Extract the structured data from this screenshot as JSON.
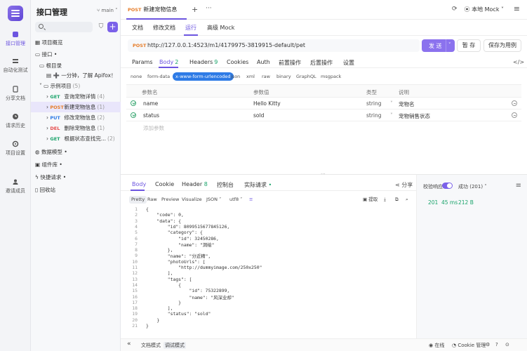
{
  "rail": {
    "items": [
      {
        "label": "接口管理",
        "icon": "api-icon"
      },
      {
        "label": "自动化测试",
        "icon": "automation-icon"
      },
      {
        "label": "分享文档",
        "icon": "share-doc-icon"
      },
      {
        "label": "请求历史",
        "icon": "history-icon"
      },
      {
        "label": "项目设置",
        "icon": "settings-icon"
      },
      {
        "label": "邀请成员",
        "icon": "invite-icon"
      }
    ]
  },
  "tree": {
    "project_title": "接口管理",
    "branch": "main",
    "nodes": {
      "overview": "项目概览",
      "api": "接口",
      "root": "根目录",
      "welcome": "➕ 一分钟，了解 Apifox！",
      "example": "示例项目",
      "example_count": "(5)",
      "data_model": "数据模型",
      "component": "组件库",
      "quick_request": "快捷请求",
      "trash": "回收站"
    },
    "endpoints": [
      {
        "method": "GET",
        "name": "查询宠物详情",
        "count": "(4)"
      },
      {
        "method": "POST",
        "name": "新建宠物信息",
        "count": "(1)"
      },
      {
        "method": "PUT",
        "name": "修改宠物信息",
        "count": "(2)"
      },
      {
        "method": "DEL",
        "name": "删除宠物信息",
        "count": "(1)"
      },
      {
        "method": "GET",
        "name": "根据状态查找完...",
        "count": "(2)"
      }
    ]
  },
  "topbar": {
    "tab_method": "POST",
    "tab_title": "新建宠物信息",
    "env": "本地 Mock"
  },
  "subtabs": [
    "文档",
    "修改文档",
    "运行",
    "高级 Mock"
  ],
  "request": {
    "method": "POST",
    "url": "http://127.0.0.1:4523/m1/4179975-3819915-default/pet",
    "send": "发 送",
    "save": "暂 存",
    "save_as_case": "保存为用例"
  },
  "req_tabs": [
    {
      "label": "Params",
      "num": ""
    },
    {
      "label": "Body",
      "num": "2"
    },
    {
      "label": "Headers",
      "num": "9"
    },
    {
      "label": "Cookies",
      "num": ""
    },
    {
      "label": "Auth",
      "num": ""
    },
    {
      "label": "前置操作",
      "num": ""
    },
    {
      "label": "后置操作",
      "num": ""
    },
    {
      "label": "设置",
      "num": ""
    }
  ],
  "content_types": [
    "none",
    "form-data",
    "x-www-form-urlencoded",
    "json",
    "xml",
    "raw",
    "binary",
    "GraphQL",
    "msgpack"
  ],
  "params": {
    "headers": [
      "参数名",
      "参数值",
      "类型",
      "说明"
    ],
    "rows": [
      {
        "name": "name",
        "value": "Hello Kitty",
        "type": "string",
        "desc": "宠物名"
      },
      {
        "name": "status",
        "value": "sold",
        "type": "string",
        "desc": "宠物销售状态"
      }
    ],
    "add_placeholder": "添加参数"
  },
  "response": {
    "tabs": [
      "Body",
      "Cookie",
      "Header",
      "控制台",
      "实际请求"
    ],
    "header_count": "8",
    "share": "分享",
    "views": [
      "Pretty",
      "Raw",
      "Preview",
      "Visualize"
    ],
    "format": "JSON",
    "encoding": "utf8",
    "extract": "提取",
    "code_lines": [
      "{",
      "    \"code\": 0,",
      "    \"data\": {",
      "        \"id\": 8099515677845126,",
      "        \"category\": {",
      "            \"id\": 32450286,",
      "            \"name\": \"洞绘\"",
      "        },",
      "        \"name\": \"分近精\",",
      "        \"photoUrls\": [",
      "            \"http://dummyimage.com/250x250\"",
      "        ],",
      "        \"tags\": [",
      "            {",
      "                \"id\": 75322899,",
      "                \"name\": \"风深业却\"",
      "            }",
      "        ],",
      "        \"status\": \"sold\"",
      "    }",
      "}"
    ]
  },
  "status_panel": {
    "validate_label": "校验响应",
    "result": "成功 (201)",
    "code": "201",
    "time": "45 ms",
    "size": "212 B"
  },
  "bottom": {
    "doc_mode": "文档模式",
    "debug_mode": "调试模式",
    "online": "在线",
    "cookie": "Cookie 管理"
  }
}
